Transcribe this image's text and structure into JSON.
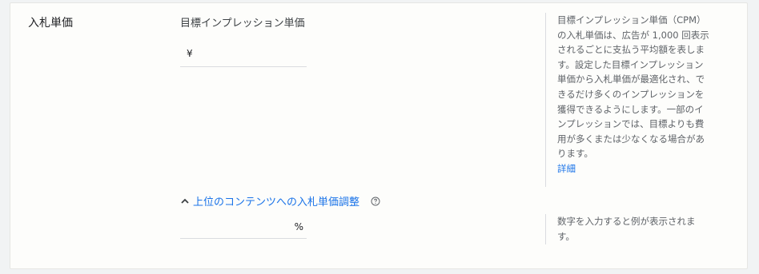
{
  "section": {
    "title": "入札単価"
  },
  "bid": {
    "label": "目標インプレッション単価",
    "currency_symbol": "¥",
    "value": ""
  },
  "help_top": {
    "text": "目標インプレッション単価（CPM）の入札単価は、広告が 1,000 回表示されるごとに支払う平均額を表します。設定した目標インプレッション単価から入札単価が最適化され、できるだけ多くのインプレッションを獲得できるようにします。一部のインプレッションでは、目標よりも費用が多くまたは少なくなる場合があります。",
    "link": "詳細"
  },
  "adjustment": {
    "toggle_label": "上位のコンテンツへの入札単価調整",
    "suffix": "%",
    "value": ""
  },
  "help_bottom": {
    "text": "数字を入力すると例が表示されます。"
  },
  "colors": {
    "link": "#1a73e8",
    "muted": "#5f6368",
    "divider": "#dadce0"
  },
  "icons": {
    "toggle": "chevron-up-icon",
    "help": "help-circle-icon"
  }
}
